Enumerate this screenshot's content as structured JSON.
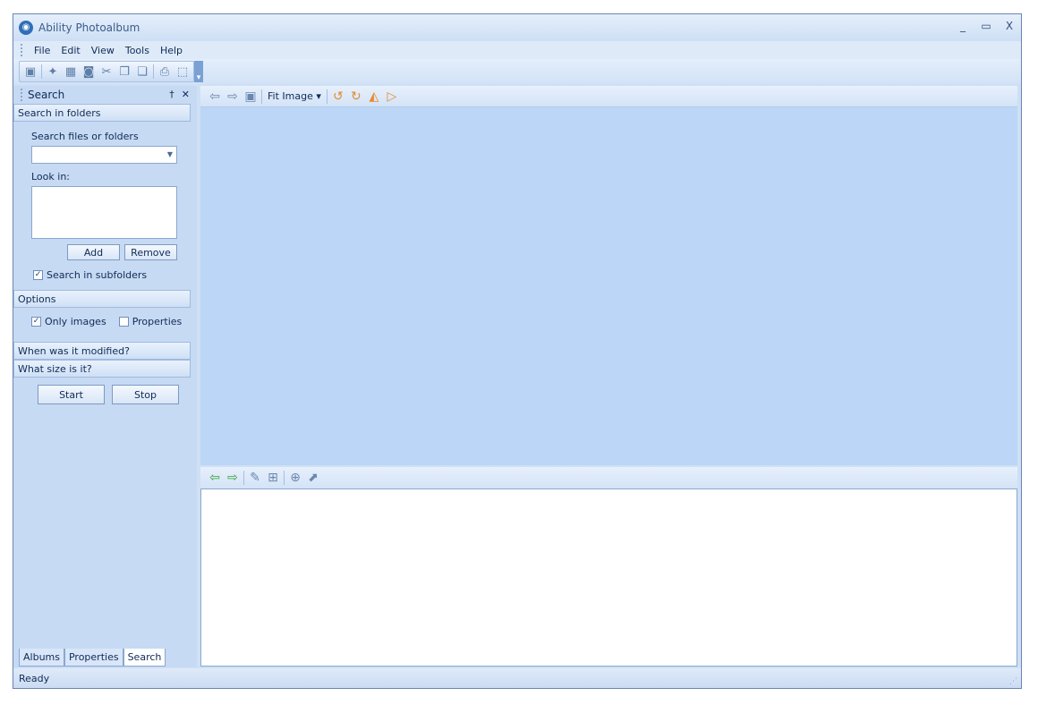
{
  "window": {
    "title": "Ability Photoalbum",
    "controls": [
      "_",
      "▭",
      "X"
    ]
  },
  "menu": [
    "File",
    "Edit",
    "View",
    "Tools",
    "Help"
  ],
  "search_pane": {
    "title": "Search",
    "pin": "†",
    "close": "✕",
    "section_folders": "Search in folders",
    "search_label": "Search files or folders",
    "search_value": "",
    "lookin_label": "Look in:",
    "add": "Add",
    "remove": "Remove",
    "subfolders": "Search in subfolders",
    "section_options": "Options",
    "only_images": "Only images",
    "properties_chk": "Properties",
    "section_modified": "When was it modified?",
    "section_size": "What size is it?",
    "start": "Start",
    "stop": "Stop"
  },
  "tabs": [
    "Albums",
    "Properties",
    "Search"
  ],
  "viewer": {
    "fit": "Fit Image ▾"
  },
  "status": {
    "text": "Ready"
  }
}
